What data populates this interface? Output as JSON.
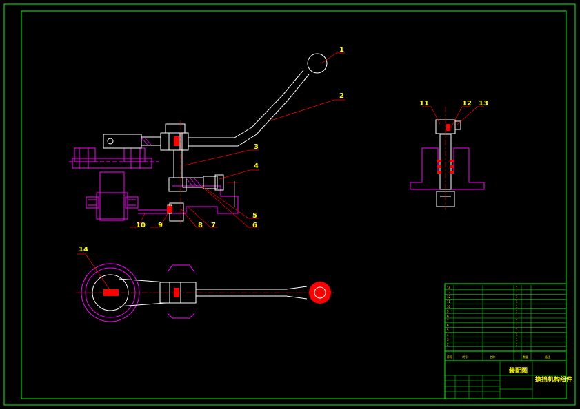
{
  "colors": {
    "background": "#000000",
    "frame": "#00ff00",
    "outline": "#ffffff",
    "leader": "#ff0000",
    "label": "#ffff00",
    "part_fill": "#ff00ff",
    "hidden": "#00ffff"
  },
  "callouts": [
    "1",
    "2",
    "3",
    "4",
    "5",
    "6",
    "7",
    "8",
    "9",
    "10",
    "11",
    "12",
    "13",
    "14"
  ],
  "title_block": {
    "drawing_type": "装配图",
    "drawing_name": "換挡机构组件",
    "header_cols": [
      "序号",
      "代号",
      "名称",
      "数量",
      "备注"
    ],
    "bom_rows": [
      {
        "no": "14",
        "code": "",
        "name": "",
        "qty": "1",
        "note": ""
      },
      {
        "no": "13",
        "code": "",
        "name": "",
        "qty": "1",
        "note": ""
      },
      {
        "no": "12",
        "code": "",
        "name": "",
        "qty": "1",
        "note": ""
      },
      {
        "no": "11",
        "code": "",
        "name": "",
        "qty": "1",
        "note": ""
      },
      {
        "no": "10",
        "code": "",
        "name": "",
        "qty": "1",
        "note": ""
      },
      {
        "no": "9",
        "code": "",
        "name": "",
        "qty": "1",
        "note": ""
      },
      {
        "no": "8",
        "code": "",
        "name": "",
        "qty": "1",
        "note": ""
      },
      {
        "no": "7",
        "code": "",
        "name": "",
        "qty": "1",
        "note": ""
      },
      {
        "no": "6",
        "code": "",
        "name": "",
        "qty": "1",
        "note": ""
      },
      {
        "no": "5",
        "code": "",
        "name": "",
        "qty": "1",
        "note": ""
      },
      {
        "no": "4",
        "code": "",
        "name": "",
        "qty": "1",
        "note": ""
      },
      {
        "no": "3",
        "code": "",
        "name": "",
        "qty": "1",
        "note": ""
      },
      {
        "no": "2",
        "code": "",
        "name": "",
        "qty": "1",
        "note": ""
      },
      {
        "no": "1",
        "code": "",
        "name": "",
        "qty": "1",
        "note": ""
      }
    ]
  }
}
